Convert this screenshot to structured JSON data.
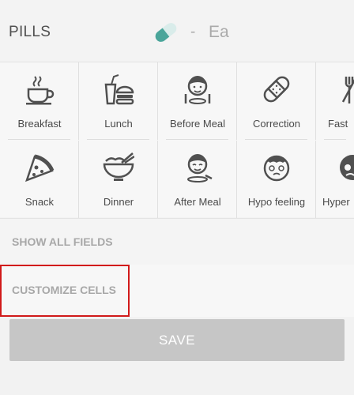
{
  "pills_row": {
    "label": "PILLS",
    "dash": "-",
    "unit_preview": "Ea",
    "pill_color": "#4aa59a"
  },
  "cells": [
    {
      "label": "Breakfast",
      "icon": "coffee-cup-icon"
    },
    {
      "label": "Lunch",
      "icon": "burger-drink-icon"
    },
    {
      "label": "Before Meal",
      "icon": "person-before-meal-icon"
    },
    {
      "label": "Correction",
      "icon": "bandage-icon"
    },
    {
      "label": "Fast",
      "icon": "fork-knife-icon"
    },
    {
      "label": "Snack",
      "icon": "pizza-slice-icon"
    },
    {
      "label": "Dinner",
      "icon": "bowl-chopsticks-icon"
    },
    {
      "label": "After Meal",
      "icon": "person-after-meal-icon"
    },
    {
      "label": "Hypo feeling",
      "icon": "dizzy-face-icon"
    },
    {
      "label": "Hyper",
      "icon": "hyper-face-icon"
    }
  ],
  "show_all_fields": "SHOW ALL FIELDS",
  "customize_cells": "CUSTOMIZE CELLS",
  "save_label": "SAVE",
  "colors": {
    "highlight": "#d11a1a",
    "save_bg": "#c6c6c6",
    "icon": "#505050"
  }
}
